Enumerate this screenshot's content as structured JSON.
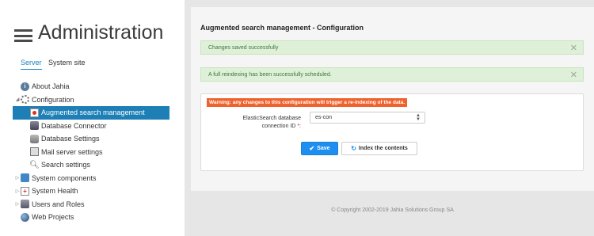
{
  "sidebar": {
    "title": "Administration",
    "tabs": [
      {
        "label": "Server",
        "active": true
      },
      {
        "label": "System site",
        "active": false
      }
    ],
    "tree": [
      {
        "label": "About Jahia",
        "icon": "info-icon",
        "level": 0,
        "arrow": ""
      },
      {
        "label": "Configuration",
        "icon": "gear-icon",
        "level": 0,
        "arrow": "◢"
      },
      {
        "label": "Augmented search management",
        "icon": "module-icon",
        "level": 1,
        "arrow": "",
        "selected": true
      },
      {
        "label": "Database Connector",
        "icon": "database-icon",
        "level": 1,
        "arrow": ""
      },
      {
        "label": "Database Settings",
        "icon": "database-settings-icon",
        "level": 1,
        "arrow": ""
      },
      {
        "label": "Mail server settings",
        "icon": "mail-icon",
        "level": 1,
        "arrow": ""
      },
      {
        "label": "Search settings",
        "icon": "search-icon",
        "level": 1,
        "arrow": ""
      },
      {
        "label": "System components",
        "icon": "puzzle-icon",
        "level": 0,
        "arrow": "▷"
      },
      {
        "label": "System Health",
        "icon": "health-icon",
        "level": 0,
        "arrow": "▷"
      },
      {
        "label": "Users and Roles",
        "icon": "users-icon",
        "level": 0,
        "arrow": "▷"
      },
      {
        "label": "Web Projects",
        "icon": "globe-icon",
        "level": 0,
        "arrow": ""
      }
    ]
  },
  "main": {
    "title": "Augmented search management - Configuration",
    "alerts": [
      {
        "text": "Changes saved successfully",
        "close": "✕"
      },
      {
        "text": "A full reindexing has been successfully scheduled.",
        "close": "✕"
      }
    ],
    "warning": "Warning: any changes to this configuration will trigger a re-indexing of the data.",
    "form": {
      "label_line1": "ElasticSearch database",
      "label_line2": "connection ID ",
      "required_mark": "*",
      "label_suffix": ":",
      "selected_value": "es-con"
    },
    "buttons": {
      "save": "Save",
      "index": "Index the contents"
    }
  },
  "footer": {
    "copyright": "© Copyright 2002-2019 Jahia Solutions Group SA"
  },
  "colors": {
    "accent": "#1d7fb6",
    "primary_button": "#1e8ff1",
    "success_bg": "#dff0d8",
    "warning_bg": "#f0622d"
  }
}
